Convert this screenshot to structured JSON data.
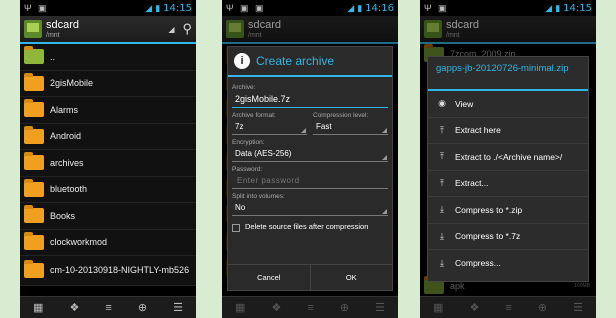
{
  "status": {
    "time1": "14:15",
    "time2": "14:16",
    "time3": "14:15"
  },
  "actionbar": {
    "title": "sdcard",
    "subtitle": "/mnt"
  },
  "list": [
    {
      "label": ".."
    },
    {
      "label": "2gisMobile"
    },
    {
      "label": "Alarms"
    },
    {
      "label": "Android"
    },
    {
      "label": "archives"
    },
    {
      "label": "bluetooth"
    },
    {
      "label": "Books"
    },
    {
      "label": "clockworkmod"
    },
    {
      "label": "cm-10-20130918-NIGHTLY-mb526"
    }
  ],
  "dialog": {
    "title": "Create archive",
    "archive_label": "Archive:",
    "archive_value": "2gisMobile.7z",
    "format_label": "Archive format:",
    "format_value": "7z",
    "compression_label": "Compression level:",
    "compression_value": "Fast",
    "encryption_label": "Encryption:",
    "encryption_value": "Data (AES-256)",
    "password_label": "Password:",
    "password_placeholder": "Enter password",
    "split_label": "Split into volumes:",
    "split_value": "No",
    "delete_label": "Delete source files after compression",
    "cancel": "Cancel",
    "ok": "OK"
  },
  "menu": {
    "title": "gapps-jb-20120726-minimal.zip",
    "items": [
      {
        "label": "View",
        "icon": "eye-icon"
      },
      {
        "label": "Extract here",
        "icon": "upload-icon"
      },
      {
        "label": "Extract to ./<Archive name>/",
        "icon": "upload-icon"
      },
      {
        "label": "Extract...",
        "icon": "upload-icon"
      },
      {
        "label": "Compress to *.zip",
        "icon": "download-icon"
      },
      {
        "label": "Compress to *.7z",
        "icon": "download-icon"
      },
      {
        "label": "Compress...",
        "icon": "download-icon"
      }
    ]
  },
  "bg3": {
    "top_row": "7zcom_2009.zip",
    "bottom_row": "apk",
    "bottom_small": "100MB"
  },
  "colors": {
    "accent": "#33b5e5",
    "folder": "#f0a020",
    "background": "#d8ecd2"
  }
}
